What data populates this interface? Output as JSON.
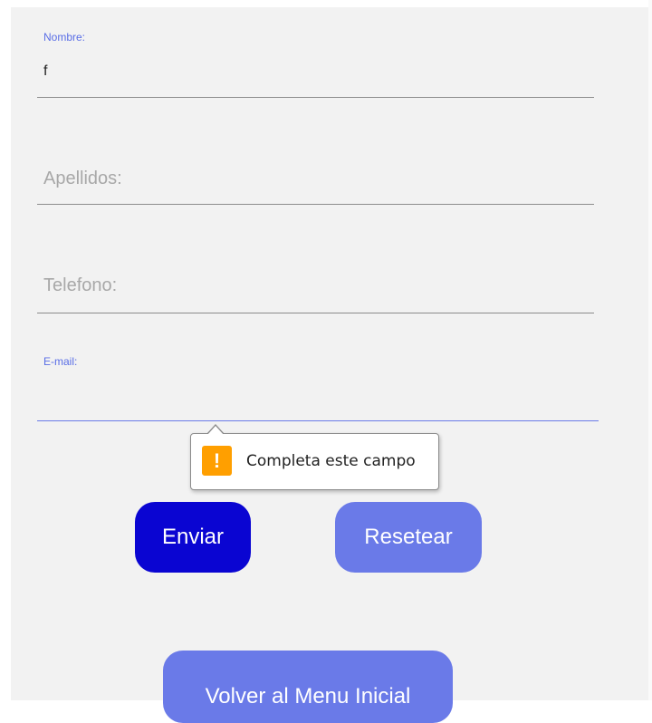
{
  "form": {
    "nombre": {
      "label": "Nombre:",
      "value": "f"
    },
    "apellidos": {
      "placeholder": "Apellidos:"
    },
    "telefono": {
      "placeholder": "Telefono:"
    },
    "email": {
      "label": "E-mail:",
      "value": ""
    }
  },
  "validation_tooltip": {
    "icon": "warning-icon",
    "icon_glyph": "!",
    "message": "Completa este campo"
  },
  "buttons": {
    "send_label": "Enviar",
    "reset_label": "Resetear",
    "back_label": "Volver al Menu Inicial"
  },
  "colors": {
    "send_button": "#0a05d2",
    "secondary_button": "#6a7ae8",
    "focus_accent": "#5a6ee6",
    "warning": "#ff9f00"
  }
}
